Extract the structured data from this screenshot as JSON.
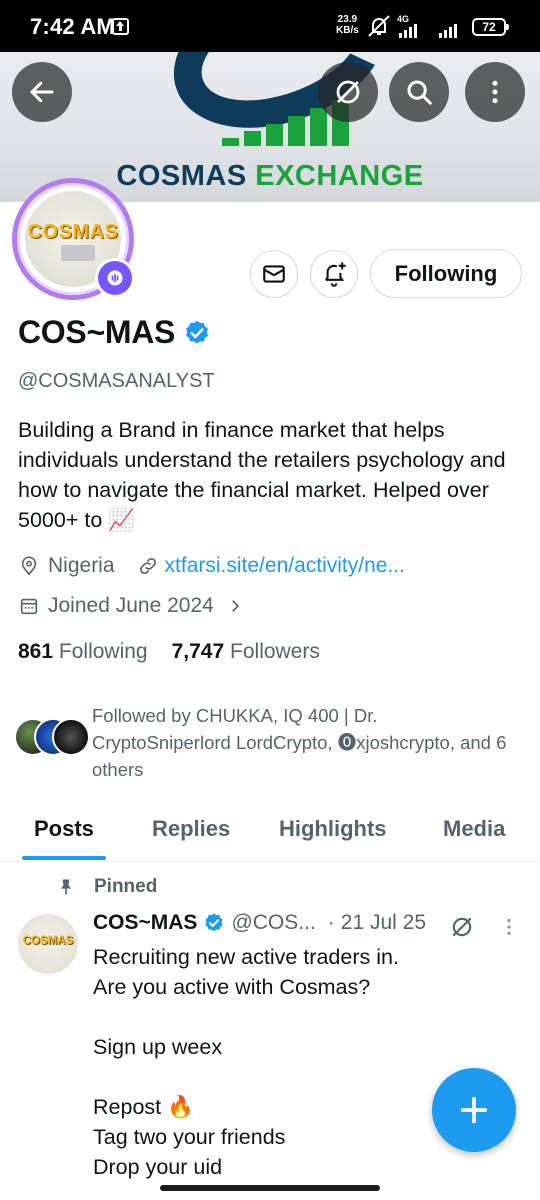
{
  "status_bar": {
    "time": "7:42 AM",
    "net_speed_value": "23.9",
    "net_speed_unit": "KB/s",
    "network_type": "4G",
    "battery": "72"
  },
  "banner": {
    "brand_word1": "COSMAS",
    "brand_word2": "EXCHANGE"
  },
  "avatar": {
    "text": "COSMAS"
  },
  "actions": {
    "following_label": "Following"
  },
  "profile": {
    "display_name": "COS~MAS",
    "handle": "@COSMASANALYST",
    "bio": "Building a Brand in finance market that helps individuals understand the retailers psychology and how to navigate the financial market. Helped over 5000+ to 📈",
    "location": "Nigeria",
    "website": "xtfarsi.site/en/activity/ne...",
    "joined": "Joined June 2024",
    "following_count": "861",
    "following_label": "Following",
    "followers_count": "7,747",
    "followers_label": "Followers",
    "followed_by": "Followed by CHUKKA, IQ 400 | Dr. CryptoSniperlord LordCrypto, ⓿xjoshcrypto, and 6 others"
  },
  "tabs": [
    {
      "label": "Posts",
      "active": true
    },
    {
      "label": "Replies",
      "active": false
    },
    {
      "label": "Highlights",
      "active": false
    },
    {
      "label": "Media",
      "active": false
    }
  ],
  "post": {
    "pinned_label": "Pinned",
    "author_name": "COS~MAS",
    "author_handle": "@COS...",
    "separator": "·",
    "date": "21 Jul 25",
    "avatar_text": "COSMAS",
    "body": "Recruiting new active traders in.\nAre you active with Cosmas?\n\nSign up weex\n\nRepost 🔥\nTag two your friends\nDrop your uid"
  },
  "colors": {
    "accent": "#1d9bf0",
    "secondary_text": "#536471",
    "primary_text": "#0f1419",
    "spaces_purple": "#7856ff",
    "avatar_ring": "#b27cf0"
  }
}
